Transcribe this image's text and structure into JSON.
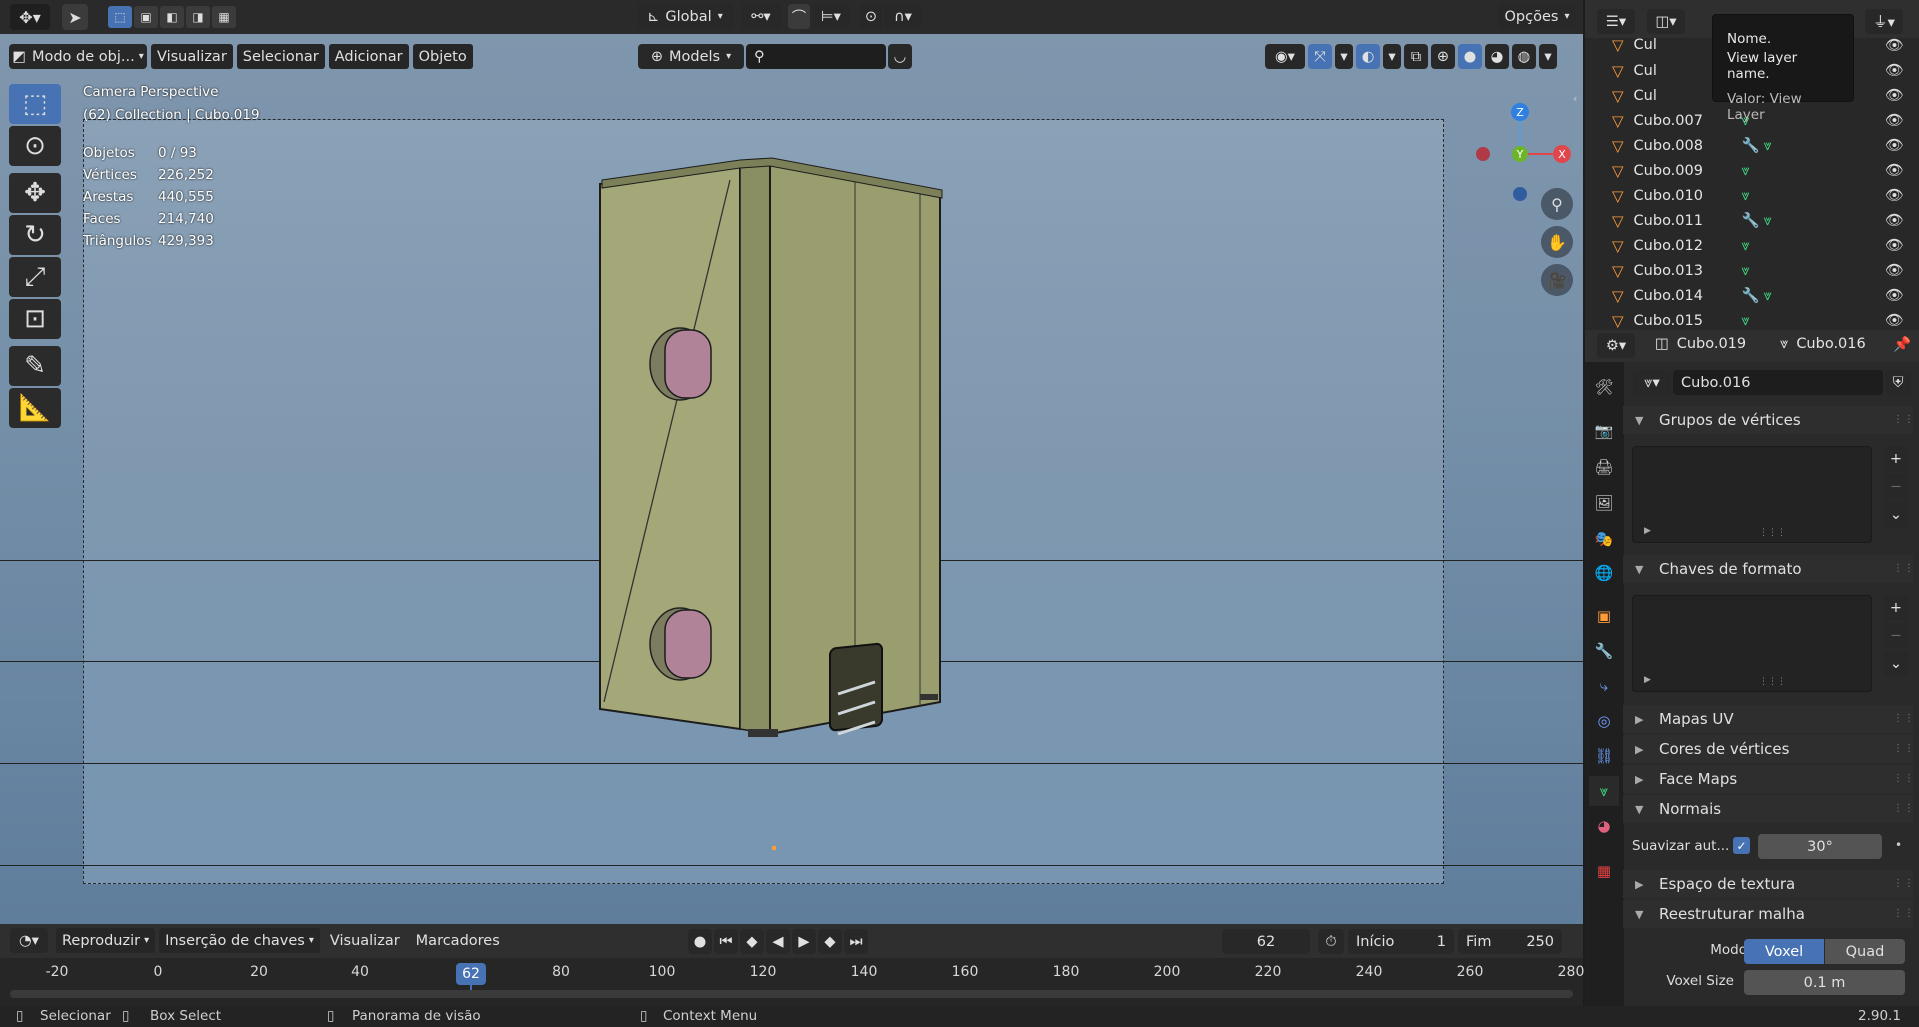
{
  "viewport": {
    "header": {
      "mode": "Modo de obj...",
      "menus": [
        "Visualizar",
        "Selecionar",
        "Adicionar",
        "Objeto"
      ],
      "orientation": "Global",
      "options": "Opções",
      "collection": "Models"
    },
    "camera_label": "Camera Perspective",
    "collection_label": "(62) Collection | Cubo.019",
    "stats": [
      [
        "Objetos",
        "0 / 93"
      ],
      [
        "Vértices",
        "226,252"
      ],
      [
        "Arestas",
        "440,555"
      ],
      [
        "Faces",
        "214,740"
      ],
      [
        "Triângulos",
        "429,393"
      ]
    ]
  },
  "outliner": {
    "partial": [
      "Cul",
      "Cul",
      "Cul"
    ],
    "items": [
      "Cubo.007",
      "Cubo.008",
      "Cubo.009",
      "Cubo.010",
      "Cubo.011",
      "Cubo.012",
      "Cubo.013",
      "Cubo.014",
      "Cubo.015"
    ]
  },
  "tooltip": {
    "line1": "Nome.",
    "line2": "View layer name.",
    "line3": "Valor: View Layer"
  },
  "properties": {
    "object": "Cubo.019",
    "data": "Cubo.016",
    "mesh_name": "Cubo.016",
    "panels": {
      "vgroups": "Grupos de vértices",
      "shapekeys": "Chaves de formato",
      "uv": "Mapas UV",
      "vcol": "Cores de vértices",
      "facemaps": "Face Maps",
      "normals": "Normais",
      "autosmooth": "Suavizar aut...",
      "angle": "30°",
      "texspace": "Espaço de textura",
      "remesh": "Reestruturar malha",
      "mode": "Modo",
      "voxel": "Voxel",
      "quad": "Quad",
      "voxel_size_label": "Voxel Size",
      "voxel_size": "0.1 m"
    }
  },
  "timeline": {
    "menus": [
      "Reproduzir",
      "Inserção de chaves",
      "Visualizar",
      "Marcadores"
    ],
    "current_frame": "62",
    "start_label": "Início",
    "start": "1",
    "end_label": "Fim",
    "end": "250",
    "ticks": [
      "-20",
      "0",
      "20",
      "40",
      "62",
      "80",
      "100",
      "120",
      "140",
      "160",
      "180",
      "200",
      "220",
      "240",
      "260",
      "280"
    ]
  },
  "status": {
    "select": "Selecionar",
    "box": "Box Select",
    "pan": "Panorama de visão",
    "ctx": "Context Menu",
    "version": "2.90.1"
  },
  "colors": {
    "accent": "#4772b3",
    "object_orange": "#ff9c3a",
    "mesh_green": "#3fd47f"
  }
}
